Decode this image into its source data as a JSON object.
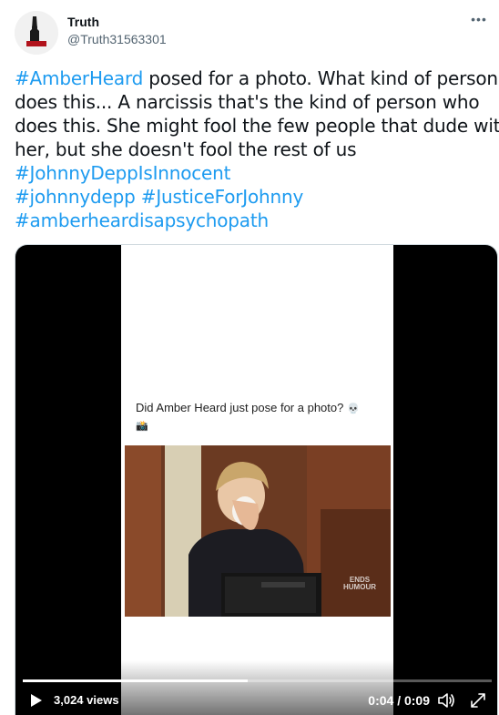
{
  "tweet": {
    "author_name": "Truth",
    "author_handle": "@Truth31563301",
    "lines": [
      [
        {
          "t": "#AmberHeard",
          "tag": true
        },
        {
          "t": " posed for a photo. What kind of person",
          "tag": false
        }
      ],
      [
        {
          "t": "does this... A narcissis that's the kind of person who",
          "tag": false
        }
      ],
      [
        {
          "t": "does this. She might fool the few people that dude with",
          "tag": false
        }
      ],
      [
        {
          "t": "her, but she doesn't fool the rest of us",
          "tag": false
        }
      ],
      [
        {
          "t": "#JohnnyDeppIsInnocent",
          "tag": true
        }
      ],
      [
        {
          "t": "#johnnydepp",
          "tag": true
        },
        {
          "t": " ",
          "tag": false
        },
        {
          "t": "#JusticeForJohnny",
          "tag": true
        }
      ],
      [
        {
          "t": "#amberheardisapsychopath",
          "tag": true
        }
      ]
    ]
  },
  "video": {
    "caption": "Did Amber Heard just pose for a photo?",
    "caption_emoji_1": "💀",
    "caption_emoji_2": "📸",
    "watermark_line1": "ENDS",
    "watermark_line2": "HUMOUR",
    "views": "3,024 views",
    "time": "0:04 / 0:09",
    "progress": 0.48
  },
  "icons": {
    "more": "more-options-icon",
    "play": "play-icon",
    "volume": "volume-icon",
    "fullscreen": "fullscreen-icon"
  },
  "colors": {
    "hashtag": "#1d9bf0",
    "handle": "#536471"
  }
}
